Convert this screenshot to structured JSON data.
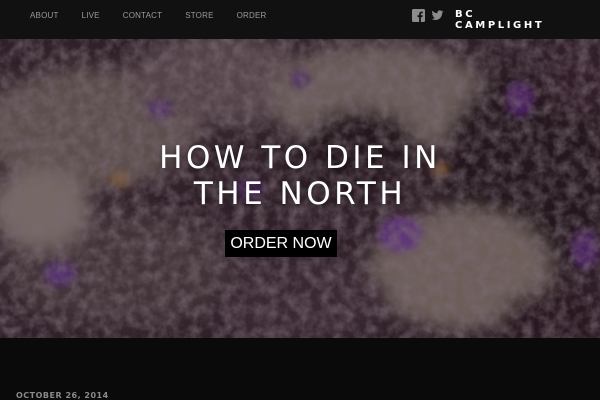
{
  "nav": {
    "links": [
      "ABOUT",
      "LIVE",
      "CONTACT",
      "STORE",
      "ORDER"
    ]
  },
  "social": {
    "icons": [
      "facebook-icon",
      "twitter-icon"
    ]
  },
  "logo": {
    "line1": "BC",
    "line2": "CAMPLIGHT"
  },
  "hero": {
    "title_line1": "HOW TO DIE IN",
    "title_line2": "THE NORTH",
    "button_label": "ORDER NOW"
  },
  "post": {
    "date": "OCTOBER 26, 2014"
  },
  "colors": {
    "navbar_bg": "#111111",
    "nav_text": "#9a9a9a",
    "page_bg": "#0a0a0a",
    "button_bg": "#000000",
    "accent_purple": "#7a3fa8"
  }
}
